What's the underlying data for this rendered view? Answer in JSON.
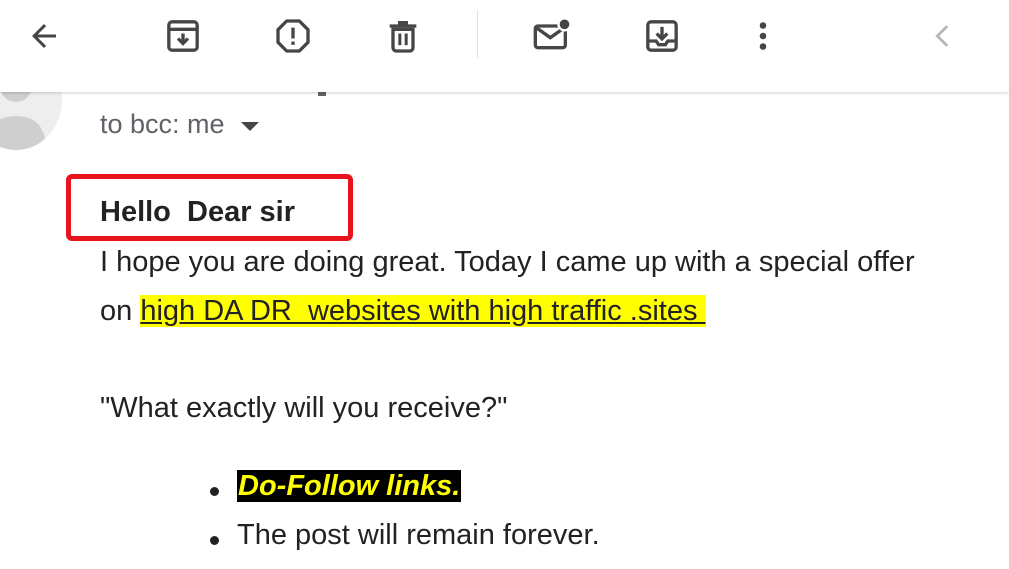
{
  "toolbar": {
    "buttons": [
      {
        "icon": "back-arrow-icon"
      },
      {
        "icon": "archive-icon"
      },
      {
        "icon": "report-spam-icon"
      },
      {
        "icon": "delete-icon"
      },
      {
        "icon": "mark-unread-icon"
      },
      {
        "icon": "move-to-icon"
      },
      {
        "icon": "more-options-icon"
      },
      {
        "icon": "chevron-left-icon"
      }
    ]
  },
  "header": {
    "recipient": "to bcc: me"
  },
  "body": {
    "greeting": "Hello  Dear sir",
    "line1": "I hope you are doing great. Today I came up with a special offer",
    "line2_prefix": "on ",
    "line2_link": "high DA DR  websites with high traffic .sites ",
    "question": "\"What exactly will you receive?\"",
    "bullets": [
      "Do-Follow links.",
      "The post will remain forever."
    ]
  },
  "colors": {
    "highlight_yellow": "#ffff00",
    "annotation_red": "#e8141d",
    "text": "#222222",
    "secondary_text": "#5f6368"
  }
}
